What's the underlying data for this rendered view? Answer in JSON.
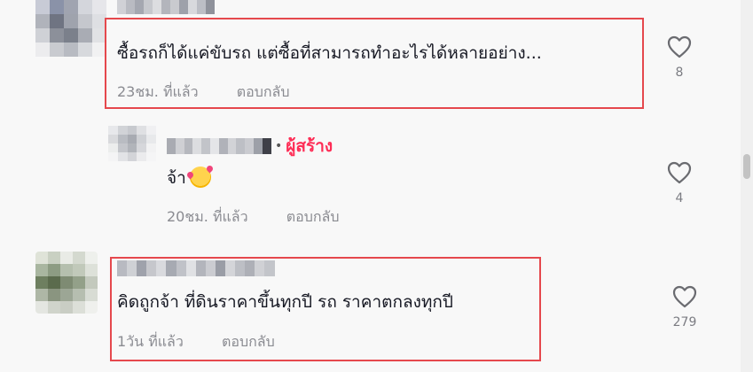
{
  "comments": [
    {
      "text": "ซื้อรถก็ได้แค่ขับรถ แต่ซื้อที่สามารถทำอะไรได้หลายอย่าง...",
      "time": "23ชม. ที่แล้ว",
      "reply_label": "ตอบกลับ",
      "likes": "8"
    },
    {
      "author_badge": "ผู้สร้าง",
      "text": "จ้า",
      "emoji": "smiling-face-with-hearts",
      "time": "20ชม. ที่แล้ว",
      "reply_label": "ตอบกลับ",
      "likes": "4"
    },
    {
      "text": "คิดถูกจ้า ที่ดินราคาขึ้นทุกปี รถ ราคาตกลงทุกปี",
      "time": "1วัน ที่แล้ว",
      "reply_label": "ตอบกลับ",
      "likes": "279"
    }
  ],
  "colors": {
    "highlight_box": "#e5484d",
    "creator_badge": "#fe2c55",
    "meta_text": "#8a8b91"
  },
  "icons": {
    "like": "heart-outline-icon"
  }
}
